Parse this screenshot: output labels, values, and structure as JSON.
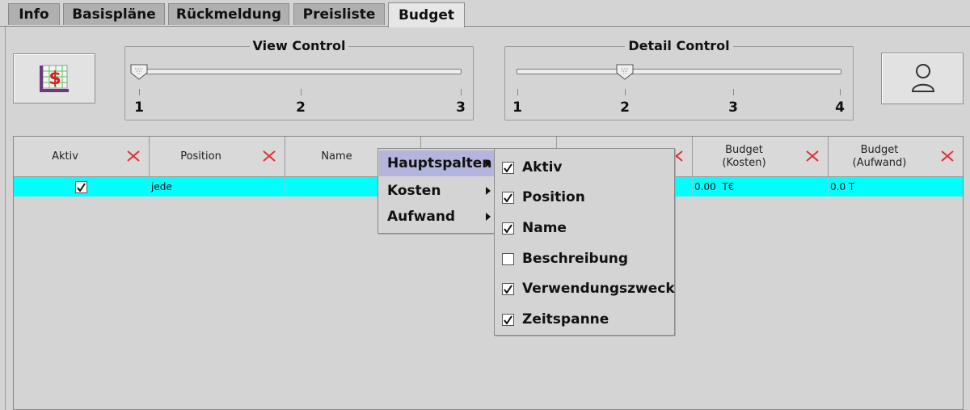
{
  "tabs": [
    {
      "label": "Info"
    },
    {
      "label": "Basispläne"
    },
    {
      "label": "Rückmeldung"
    },
    {
      "label": "Preisliste"
    },
    {
      "label": "Budget",
      "active": true
    }
  ],
  "toolbar": {
    "left_icon": "budget-chart-icon",
    "right_icon": "user-icon"
  },
  "view_control": {
    "title": "View Control",
    "ticks": [
      "1",
      "2",
      "3"
    ],
    "value": 1
  },
  "detail_control": {
    "title": "Detail Control",
    "ticks": [
      "1",
      "2",
      "3",
      "4"
    ],
    "value": 2
  },
  "table": {
    "columns": [
      {
        "label": "Aktiv"
      },
      {
        "label": "Position"
      },
      {
        "label": "Name"
      },
      {
        "label": ""
      },
      {
        "label": ""
      },
      {
        "label": "Budget\n(Kosten)"
      },
      {
        "label": "Budget\n(Aufwand)"
      }
    ],
    "rows": [
      {
        "aktiv": true,
        "position": "jede",
        "name": "",
        "budget_kosten": "0.00  T€",
        "budget_aufwand": "0.0 T"
      }
    ]
  },
  "context_menu": {
    "items": [
      {
        "label": "Hauptspalten",
        "selected": true
      },
      {
        "label": "Kosten"
      },
      {
        "label": "Aufwand"
      }
    ]
  },
  "submenu": {
    "items": [
      {
        "label": "Aktiv",
        "checked": true
      },
      {
        "label": "Position",
        "checked": true
      },
      {
        "label": "Name",
        "checked": true
      },
      {
        "label": "Beschreibung",
        "checked": false
      },
      {
        "label": "Verwendungszweck",
        "checked": true
      },
      {
        "label": "Zeitspanne",
        "checked": true
      }
    ]
  },
  "colors": {
    "selected_row": "#00ffff",
    "menu_highlight": "#b4b4dc",
    "remove_x": "#e03030"
  }
}
